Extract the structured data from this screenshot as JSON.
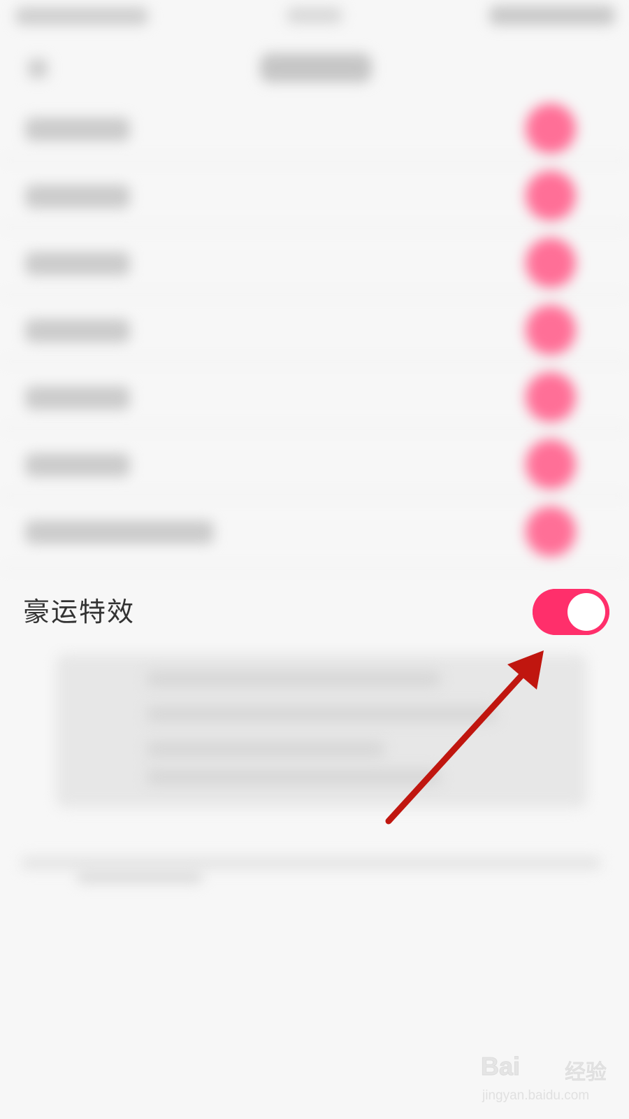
{
  "setting": {
    "label": "豪运特效",
    "toggle_on": true
  },
  "watermark": {
    "logo_text": "Bai",
    "logo_text_tail": "经验",
    "url": "jingyan.baidu.com"
  },
  "colors": {
    "toggle_on": "#ff2f6b",
    "arrow": "#c0160f",
    "blurred_dots": "#ff6f97"
  }
}
